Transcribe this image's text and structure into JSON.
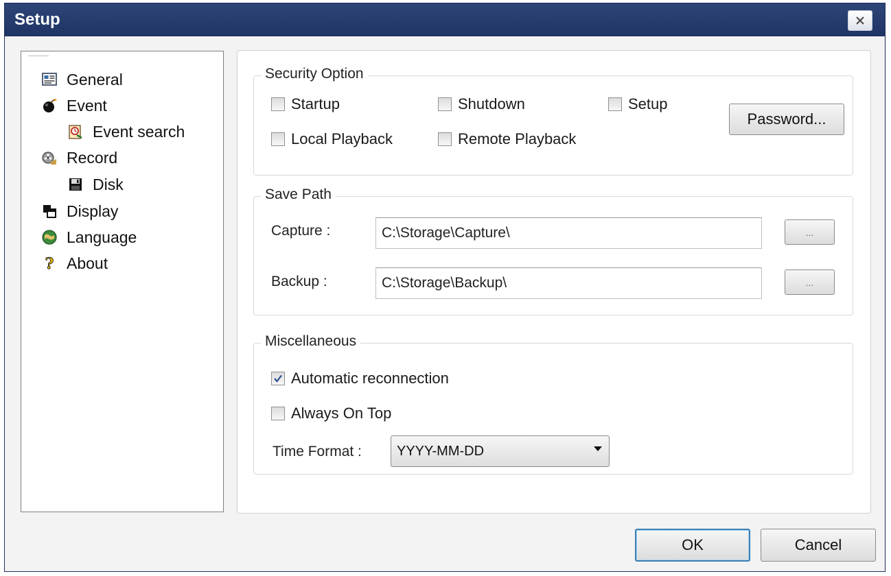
{
  "window": {
    "title": "Setup"
  },
  "tree": {
    "items": [
      {
        "label": "General",
        "icon": "general-icon"
      },
      {
        "label": "Event",
        "icon": "bomb-icon"
      },
      {
        "label": "Event search",
        "icon": "event-search-icon"
      },
      {
        "label": "Record",
        "icon": "film-reel-icon"
      },
      {
        "label": "Disk",
        "icon": "floppy-disk-icon"
      },
      {
        "label": "Display",
        "icon": "display-icon"
      },
      {
        "label": "Language",
        "icon": "globe-icon"
      },
      {
        "label": "About",
        "icon": "question-mark-icon"
      }
    ]
  },
  "security": {
    "title": "Security Option",
    "startup": {
      "label": "Startup",
      "checked": false
    },
    "shutdown": {
      "label": "Shutdown",
      "checked": false
    },
    "setup": {
      "label": "Setup",
      "checked": false
    },
    "local_playback": {
      "label": "Local Playback",
      "checked": false
    },
    "remote_playback": {
      "label": "Remote Playback",
      "checked": false
    },
    "password_button": "Password..."
  },
  "save_path": {
    "title": "Save Path",
    "capture_label": "Capture :",
    "capture_value": "C:\\Storage\\Capture\\",
    "backup_label": "Backup :",
    "backup_value": "C:\\Storage\\Backup\\",
    "browse_label": "..."
  },
  "misc": {
    "title": "Miscellaneous",
    "auto_reconnect": {
      "label": "Automatic reconnection",
      "checked": true
    },
    "always_on_top": {
      "label": "Always On Top",
      "checked": false
    },
    "time_format_label": "Time Format :",
    "time_format_value": "YYYY-MM-DD"
  },
  "footer": {
    "ok": "OK",
    "cancel": "Cancel"
  },
  "colors": {
    "titlebar": "#24396b",
    "default_button_border": "#3c7fb1"
  }
}
